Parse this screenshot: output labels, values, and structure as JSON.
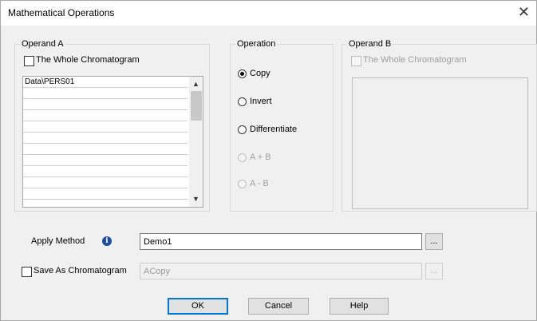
{
  "window": {
    "title": "Mathematical Operations",
    "close_glyph": "✕"
  },
  "operand_a": {
    "label": "Operand A",
    "whole_label": "The Whole Chromatogram",
    "rows": [
      "Data\\PERS01",
      "",
      "",
      "",
      "",
      "",
      "",
      "",
      "",
      "",
      ""
    ],
    "scroll_up": "▲",
    "scroll_down": "▼"
  },
  "operation": {
    "label": "Operation",
    "options": [
      "Copy",
      "Invert",
      "Differentiate",
      "A + B",
      "A - B"
    ],
    "selected": "Copy"
  },
  "operand_b": {
    "label": "Operand B",
    "whole_label": "The Whole Chromatogram"
  },
  "apply_method": {
    "label": "Apply Method",
    "info_glyph": "i",
    "value": "Demo1",
    "browse": "..."
  },
  "save_chrom": {
    "label": "Save As Chromatogram",
    "value": "ACopy",
    "browse": "..."
  },
  "buttons": {
    "ok": "OK",
    "cancel": "Cancel",
    "help": "Help"
  }
}
